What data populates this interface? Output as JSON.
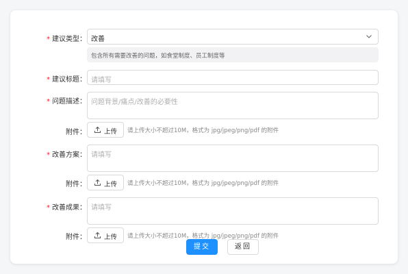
{
  "form": {
    "type": {
      "required": "*",
      "label": "建议类型：",
      "value": "改善",
      "hint": "包含所有需要改善的问题，如食堂制度、员工制度等"
    },
    "title": {
      "required": "*",
      "label": "建议标题：",
      "placeholder": "请填写"
    },
    "problem": {
      "required": "*",
      "label": "问题描述：",
      "placeholder": "问题背景/痛点/改善的必要性"
    },
    "plan": {
      "required": "*",
      "label": "改善方案：",
      "placeholder": "请填写"
    },
    "result": {
      "required": "*",
      "label": "改善成果：",
      "placeholder": "请填写"
    },
    "attachment": {
      "label": "附件：",
      "upload_label": "上传",
      "hint": "请上传大小不超过10M，格式为 jpg/jpeg/png/pdf 的附件"
    }
  },
  "actions": {
    "submit_label": "提交",
    "back_label": "返回"
  },
  "colors": {
    "primary": "#1e90ff",
    "required": "#f5222d"
  }
}
